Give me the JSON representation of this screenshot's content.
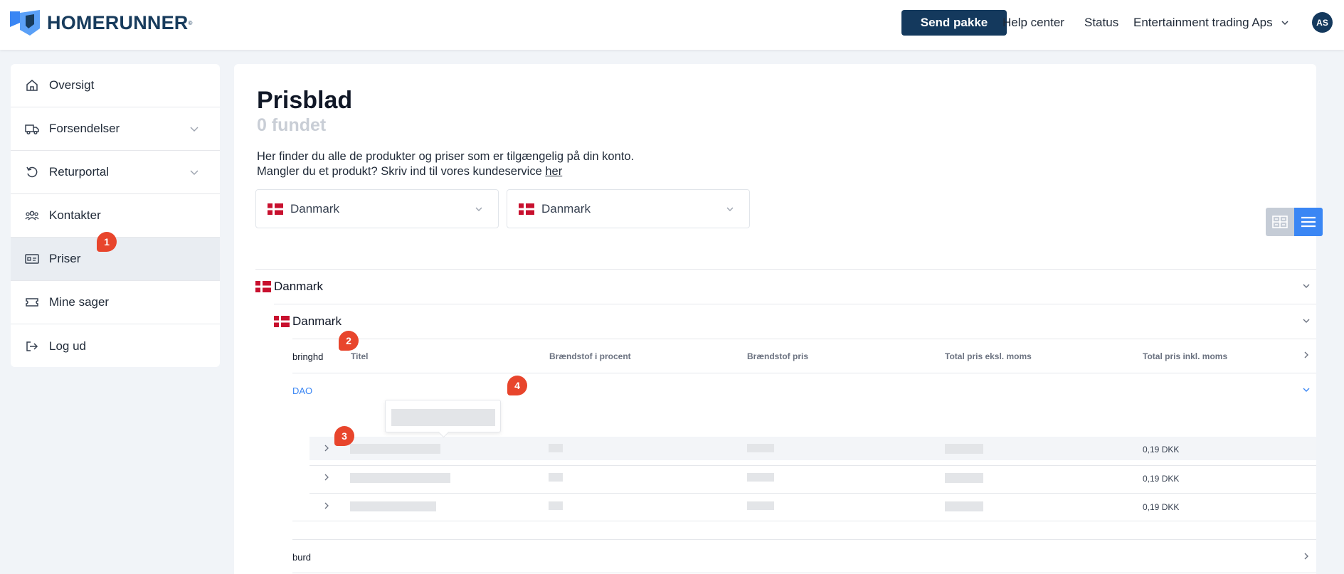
{
  "header": {
    "logo_text": "HOMERUNNER",
    "send_button": "Send pakke",
    "help_center": "Help center",
    "status": "Status",
    "account": "Entertainment trading Aps",
    "avatar": "AS"
  },
  "sidebar": {
    "items": [
      {
        "label": "Oversigt",
        "icon": "home-icon"
      },
      {
        "label": "Forsendelser",
        "icon": "truck-icon"
      },
      {
        "label": "Returportal",
        "icon": "return-icon"
      },
      {
        "label": "Kontakter",
        "icon": "contacts-icon"
      },
      {
        "label": "Priser",
        "icon": "price-icon"
      },
      {
        "label": "Mine sager",
        "icon": "ticket-icon"
      },
      {
        "label": "Log ud",
        "icon": "logout-icon"
      }
    ]
  },
  "badges": [
    "1",
    "2",
    "3",
    "4"
  ],
  "main": {
    "title": "Prisblad",
    "found": "0 fundet",
    "desc_line1": "Her finder du alle de produkter og priser som er tilgængelig på din konto.",
    "desc_line2": "Mangler du et produkt? Skriv ind til vores kundeservice",
    "desc_link": "her",
    "from_country": "Danmark",
    "to_country": "Danmark",
    "group_country": "Danmark",
    "sub_country": "Danmark",
    "carriers": [
      "bringhd",
      "DAO",
      "burd"
    ],
    "table_headers": [
      "Titel",
      "Brændstof i procent",
      "Brændstof pris",
      "Total pris eksl. moms",
      "Total pris inkl. moms"
    ],
    "rows": [
      {
        "total_incl": "0,19 DKK"
      },
      {
        "total_incl": "0,19 DKK"
      },
      {
        "total_incl": "0,19 DKK"
      }
    ]
  },
  "colors": {
    "brand": "#14395d",
    "accent": "#3a86f4",
    "badge": "#e8452c"
  }
}
